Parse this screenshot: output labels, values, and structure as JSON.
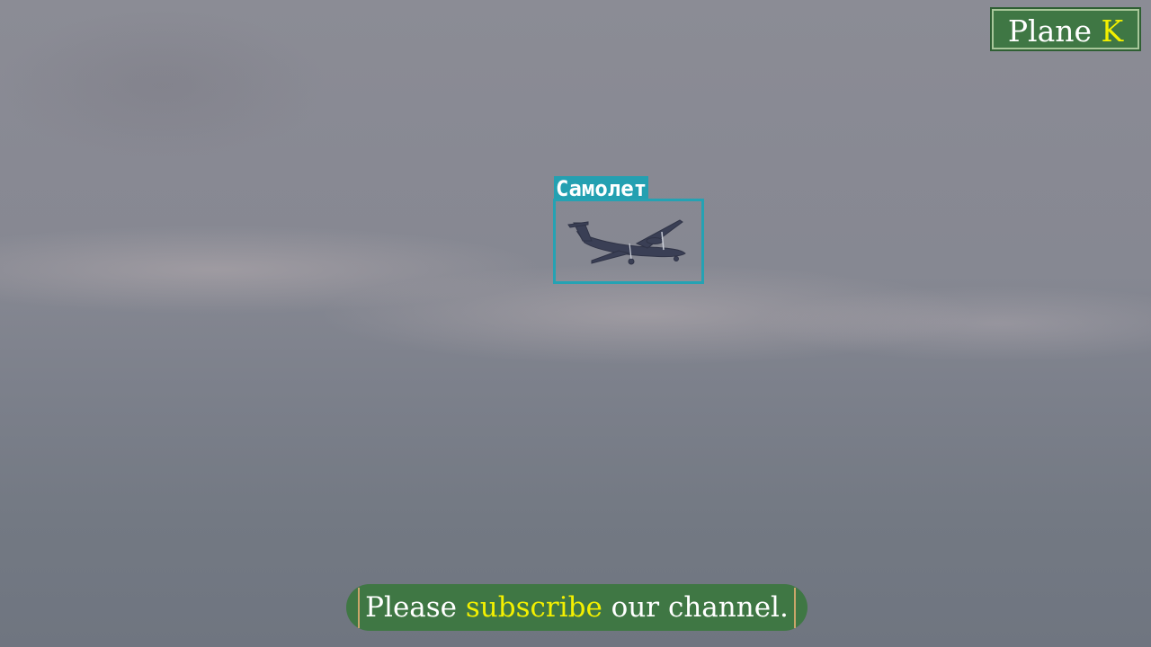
{
  "logo": {
    "text": "Plane",
    "accent": "K"
  },
  "detection": {
    "label": "Самолет"
  },
  "banner": {
    "part1": "Please ",
    "accent": "subscribe",
    "part2": " our channel."
  },
  "colors": {
    "sky": "#868892",
    "badge_green": "#3f7744",
    "accent_yellow": "#f3f000",
    "detection_cyan": "#25a2b3"
  }
}
